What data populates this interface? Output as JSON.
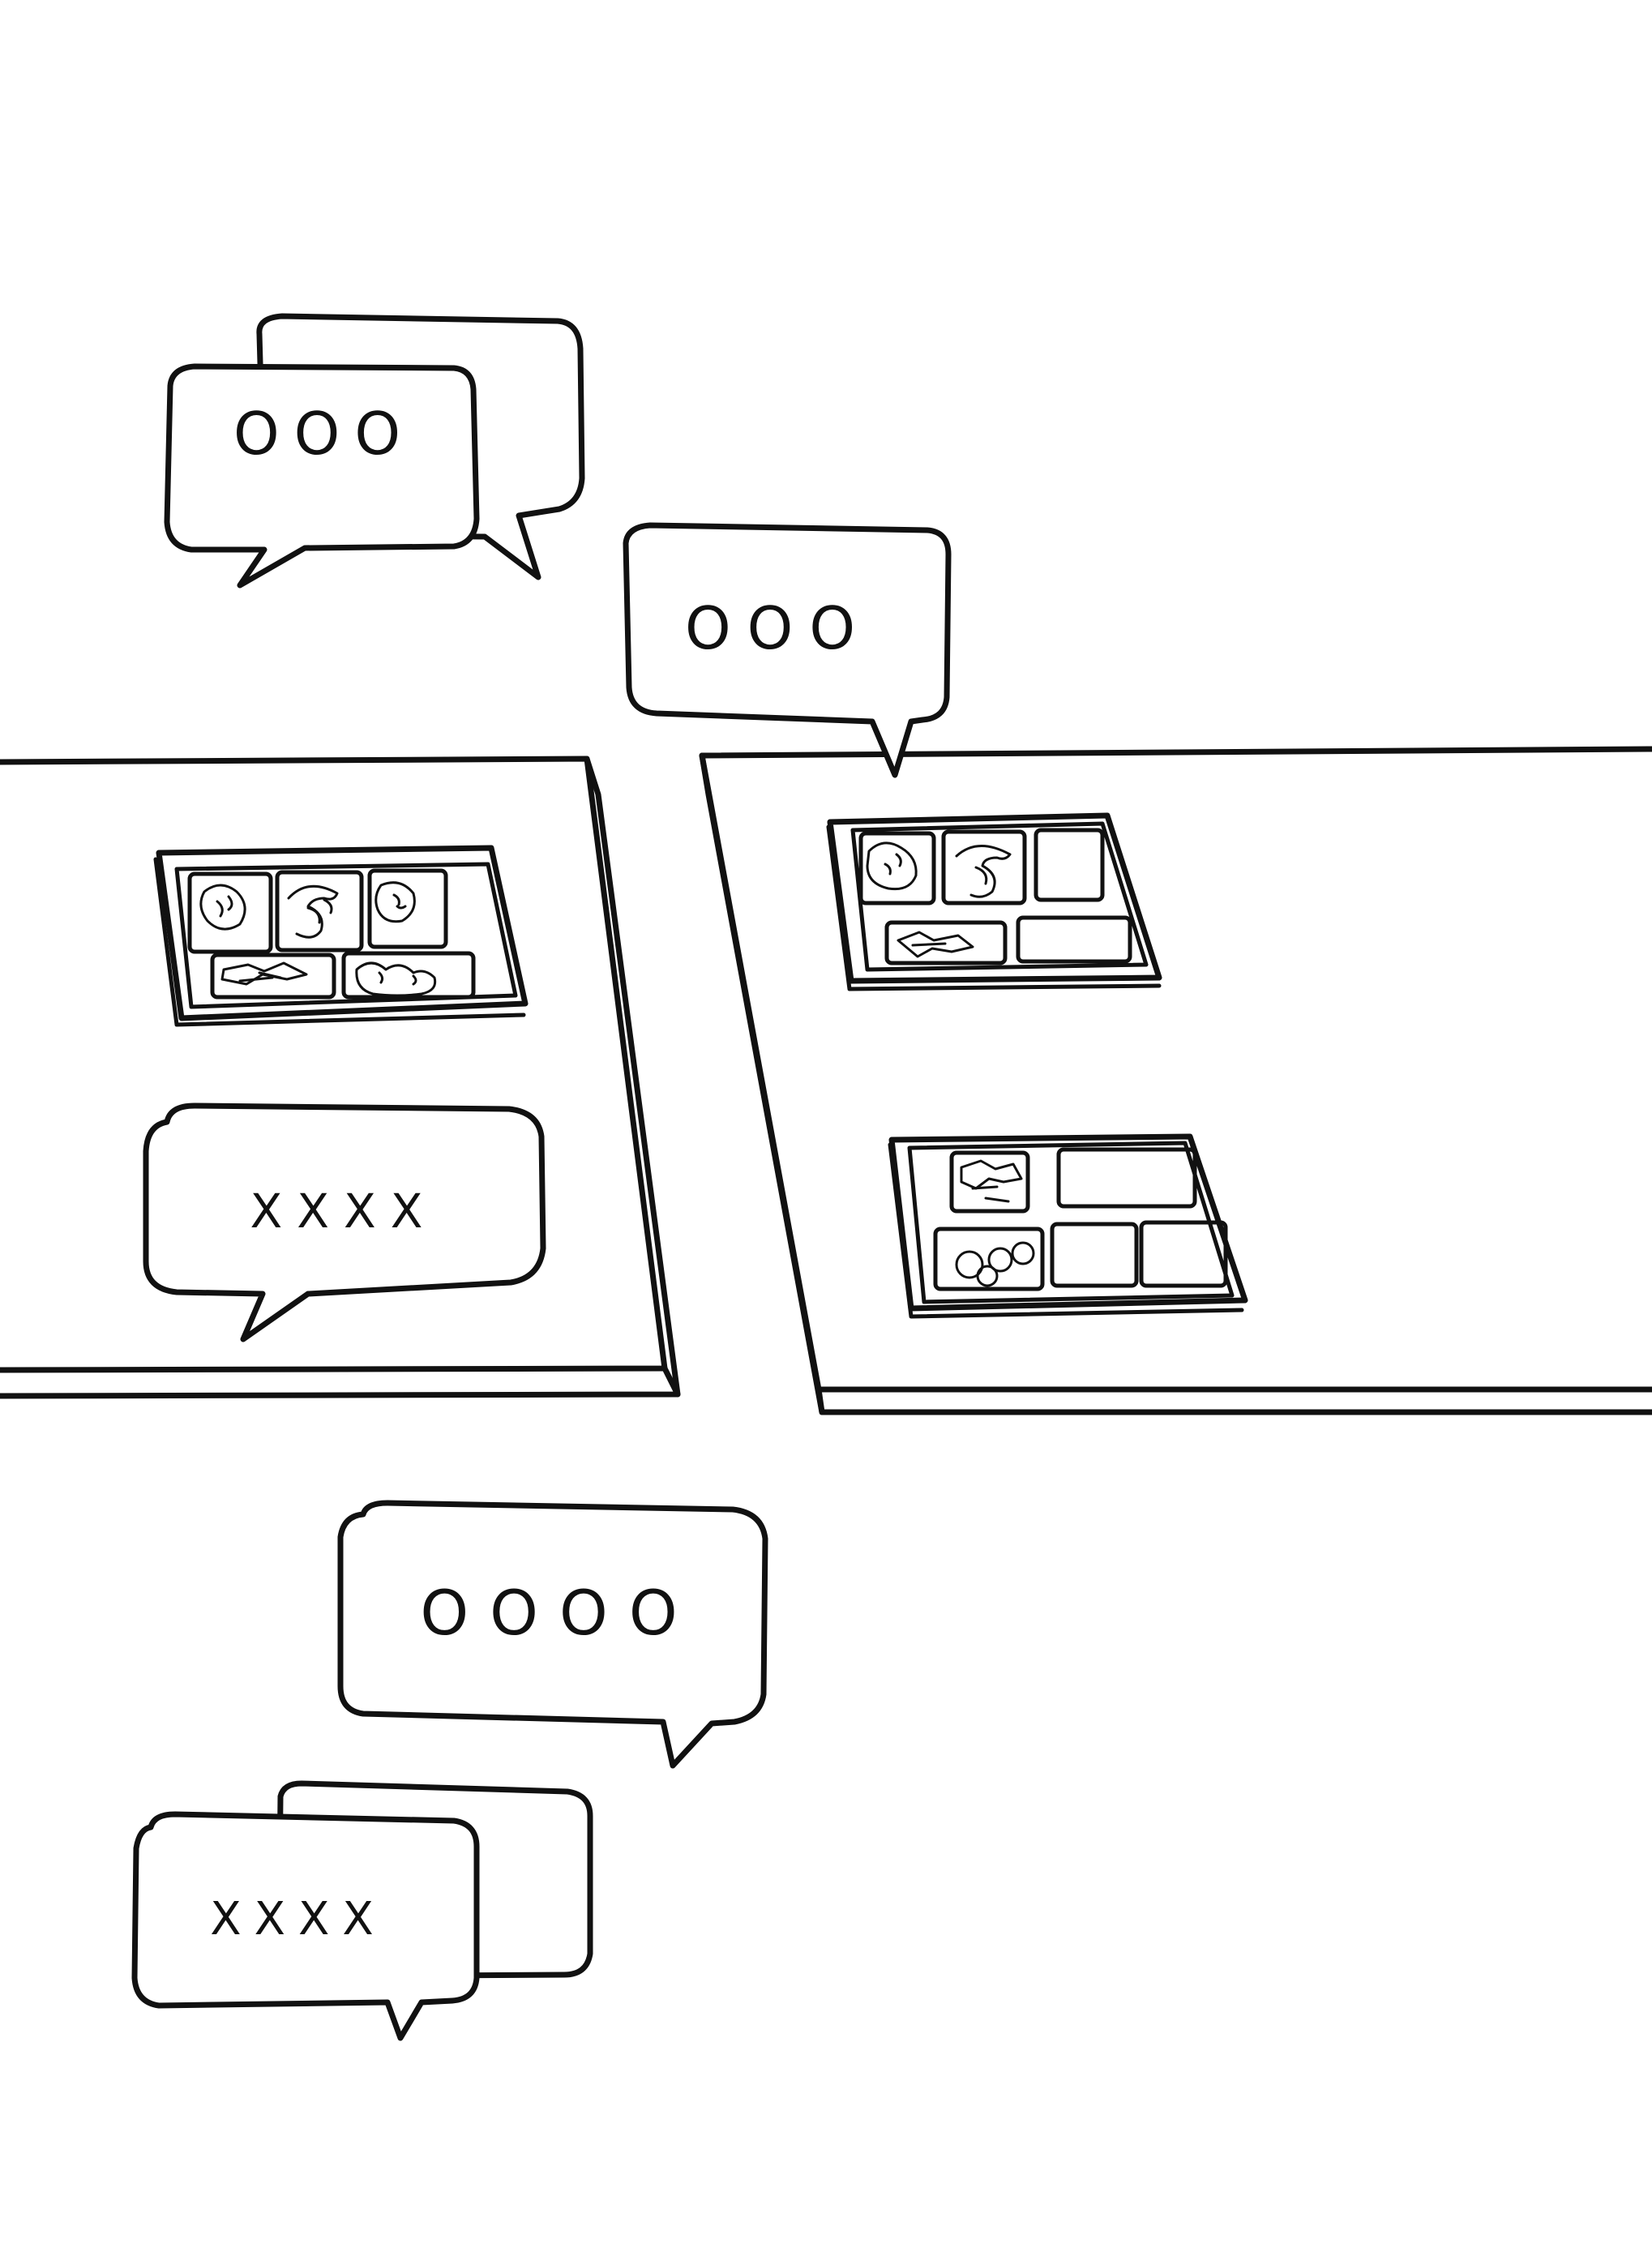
{
  "colors": {
    "ink": "#111111",
    "paper": "#ffffff"
  },
  "bubbles": [
    {
      "id": "top-left-front",
      "text": "OOO"
    },
    {
      "id": "top-center",
      "text": "OOO"
    },
    {
      "id": "table-left",
      "text": "XXXX"
    },
    {
      "id": "bottom-center",
      "text": "OOOO"
    },
    {
      "id": "bottom-left-front",
      "text": "XXXX"
    }
  ],
  "trays": [
    {
      "id": "tray-left-table",
      "compartments": 5,
      "foods": [
        "nuggets",
        "shrimp",
        "meatballs",
        "greens",
        "fried-bits"
      ]
    },
    {
      "id": "tray-right-top",
      "compartments": 5,
      "foods": [
        "fried-bits",
        "shrimp",
        "empty",
        "greens",
        "empty"
      ]
    },
    {
      "id": "tray-right-bottom",
      "compartments": 5,
      "foods": [
        "greens",
        "empty",
        "meatballs",
        "empty",
        "empty"
      ]
    }
  ]
}
